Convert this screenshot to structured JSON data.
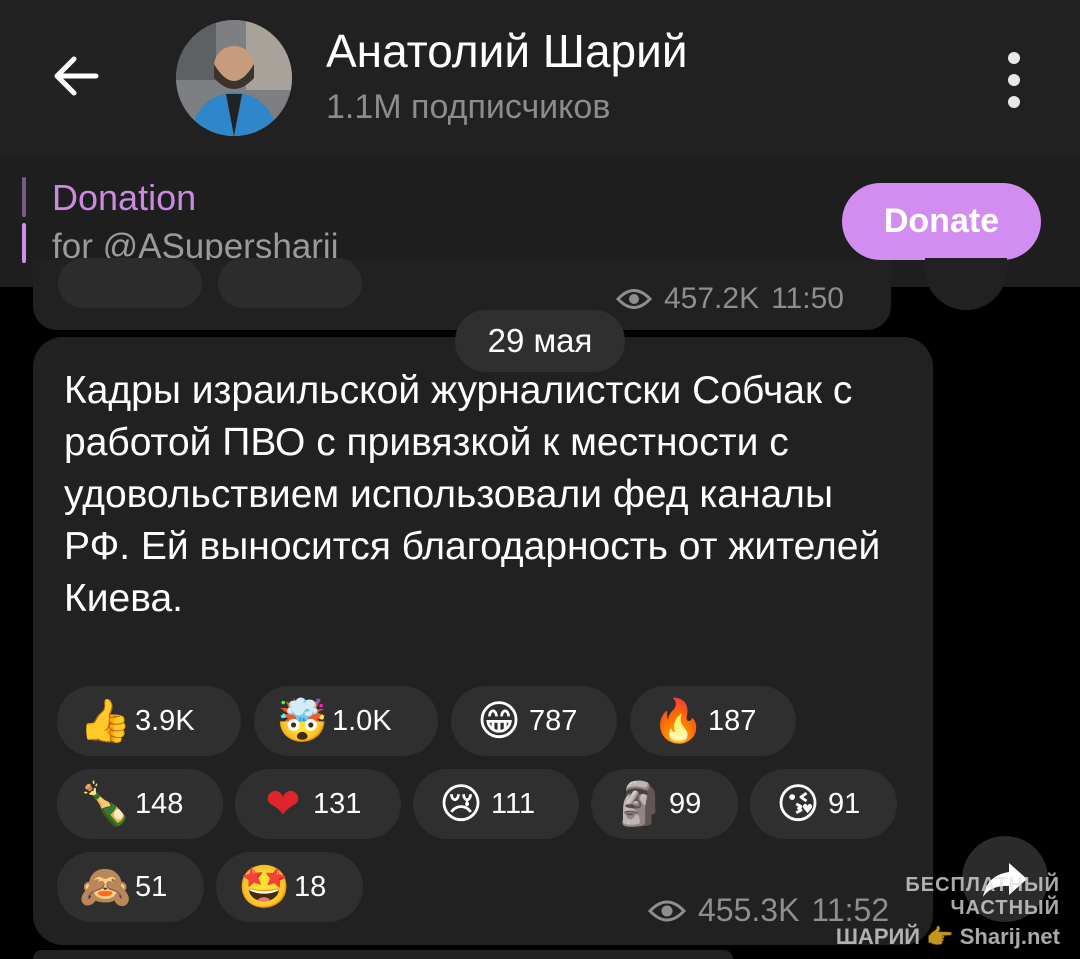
{
  "header": {
    "title": "Анатолий Шарий",
    "subscribers": "1.1M подписчиков"
  },
  "pinned": {
    "title": "Donation",
    "subtitle": "for @ASupersharij",
    "button_label": "Donate",
    "accent_color": "#d18ef0"
  },
  "previous_message": {
    "views": "457.2K",
    "time": "11:50"
  },
  "date_separator": "29 мая",
  "message": {
    "text": "Кадры израильской журналистски Собчак с работой ПВО с привязкой к местности с удовольствием использовали фед каналы РФ. Ей выносится благодарность от жителей Киева.",
    "views": "455.3K",
    "time": "11:52",
    "reactions": [
      {
        "icon": "thumbs-up-icon",
        "emoji": "👍",
        "count": "3.9K"
      },
      {
        "icon": "exploding-head-icon",
        "emoji": "🤯",
        "count": "1.0K"
      },
      {
        "icon": "grinning-face-icon",
        "emoji": "😁",
        "count": "787"
      },
      {
        "icon": "fire-icon",
        "emoji": "🔥",
        "count": "187"
      },
      {
        "icon": "champagne-icon",
        "emoji": "🍾",
        "count": "148"
      },
      {
        "icon": "red-heart-icon",
        "emoji": "❤",
        "count": "131"
      },
      {
        "icon": "crying-face-icon",
        "emoji": "😢",
        "count": "111"
      },
      {
        "icon": "moai-icon",
        "emoji": "🗿",
        "count": "99"
      },
      {
        "icon": "face-blowing-kiss-icon",
        "emoji": "😘",
        "count": "91"
      },
      {
        "icon": "see-no-evil-monkey-icon",
        "emoji": "🙈",
        "count": "51"
      },
      {
        "icon": "star-struck-icon",
        "emoji": "🤩",
        "count": "18"
      }
    ]
  },
  "watermark": {
    "line1": "БЕСПЛАТНЫЙ ЧАСТНЫЙ",
    "line2": "ШАРИЙ 👉 Sharij.net"
  }
}
